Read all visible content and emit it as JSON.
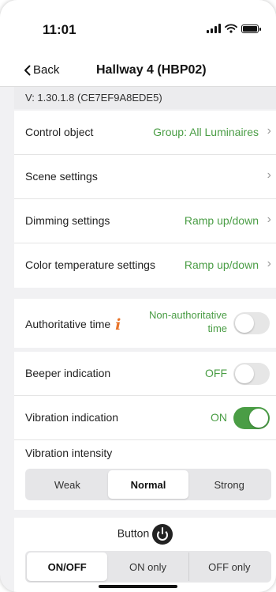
{
  "status_bar": {
    "time": "11:01"
  },
  "nav": {
    "back_label": "Back",
    "title": "Hallway 4 (HBP02)"
  },
  "version": "V: 1.30.1.8  (CE7EF9A8EDE5)",
  "settings": [
    {
      "label": "Control object",
      "value": "Group: All Luminaires"
    },
    {
      "label": "Scene settings",
      "value": ""
    },
    {
      "label": "Dimming settings",
      "value": "Ramp up/down"
    },
    {
      "label": "Color temperature settings",
      "value": "Ramp up/down"
    }
  ],
  "authoritative_time": {
    "label": "Authoritative time",
    "status_line1": "Non-authoritative",
    "status_line2": "time",
    "enabled": false
  },
  "beeper": {
    "label": "Beeper indication",
    "status": "OFF",
    "enabled": false
  },
  "vibration": {
    "label": "Vibration indication",
    "status": "ON",
    "enabled": true
  },
  "vibration_intensity": {
    "label": "Vibration intensity",
    "options": [
      "Weak",
      "Normal",
      "Strong"
    ],
    "selected": "Normal"
  },
  "button_mode": {
    "label": "Button",
    "options": [
      "ON/OFF",
      "ON only",
      "OFF only"
    ],
    "selected": "ON/OFF"
  },
  "colors": {
    "accent_green": "#4a9d45",
    "info_orange": "#e8742a"
  }
}
